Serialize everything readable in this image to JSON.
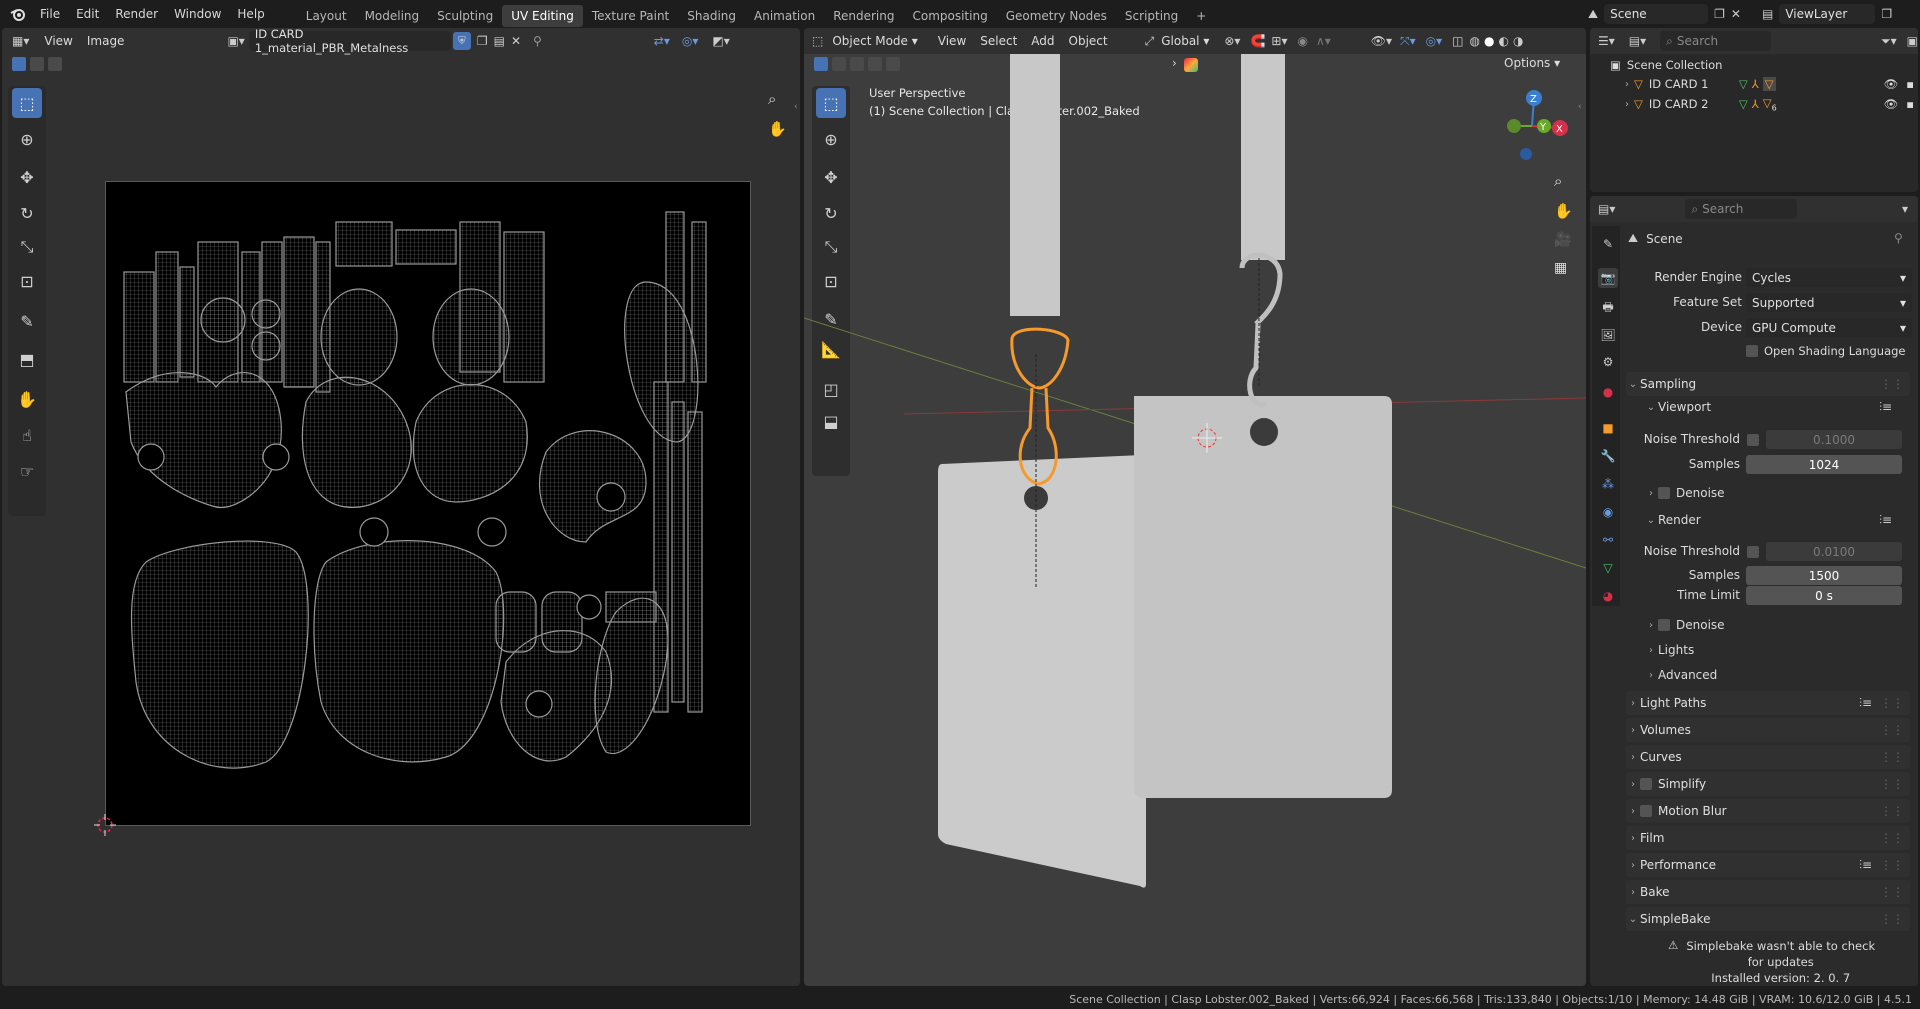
{
  "topbar": {
    "menus": [
      "File",
      "Edit",
      "Render",
      "Window",
      "Help"
    ],
    "workspaces": [
      "Layout",
      "Modeling",
      "Sculpting",
      "UV Editing",
      "Texture Paint",
      "Shading",
      "Animation",
      "Rendering",
      "Compositing",
      "Geometry Nodes",
      "Scripting"
    ],
    "active_workspace": "UV Editing",
    "add_tab": "+",
    "scene_name": "Scene",
    "view_layer": "ViewLayer"
  },
  "uv_editor": {
    "menus": [
      "View",
      "Image"
    ],
    "image_name": "ID CARD 1_material_PBR_Metalness"
  },
  "viewport": {
    "mode": "Object Mode",
    "menus": [
      "View",
      "Select",
      "Add",
      "Object"
    ],
    "transform_orientation": "Global",
    "options_label": "Options",
    "overlay_line1": "User Perspective",
    "overlay_line2": "(1) Scene Collection | Clasp Lobster.002_Baked",
    "gizmo_axes": [
      "Z",
      "Y",
      "X"
    ]
  },
  "outliner": {
    "search_placeholder": "Search",
    "root": "Scene Collection",
    "items": [
      {
        "label": "ID CARD 1",
        "badge": ""
      },
      {
        "label": "ID CARD 2",
        "badge": "6"
      }
    ]
  },
  "properties": {
    "search_placeholder": "Search",
    "context": "Scene",
    "render_engine_label": "Render Engine",
    "render_engine": "Cycles",
    "feature_set_label": "Feature Set",
    "feature_set": "Supported",
    "device_label": "Device",
    "device": "GPU Compute",
    "osl_label": "Open Shading Language",
    "sampling": {
      "title": "Sampling",
      "viewport": {
        "title": "Viewport",
        "noise_threshold_label": "Noise Threshold",
        "noise_threshold": "0.1000",
        "samples_label": "Samples",
        "samples": "1024",
        "denoise_label": "Denoise"
      },
      "render": {
        "title": "Render",
        "noise_threshold_label": "Noise Threshold",
        "noise_threshold": "0.0100",
        "samples_label": "Samples",
        "samples": "1500",
        "time_limit_label": "Time Limit",
        "time_limit": "0 s",
        "denoise_label": "Denoise"
      },
      "lights_label": "Lights",
      "advanced_label": "Advanced"
    },
    "sections": [
      "Light Paths",
      "Volumes",
      "Curves",
      "Simplify",
      "Motion Blur",
      "Film",
      "Performance",
      "Bake",
      "SimpleBake"
    ],
    "simplebake_warning": "Simplebake wasn't able to check",
    "simplebake_warning2": "for updates",
    "simplebake_version": "Installed version: 2. 0. 7"
  },
  "status_bar": "Scene Collection | Clasp Lobster.002_Baked | Verts:66,924 | Faces:66,568 | Tris:133,840 | Objects:1/10 | Memory: 14.48 GiB | VRAM: 10.6/12.0 GiB | 4.5.1",
  "colors": {
    "accent": "#4772b3",
    "selection": "#f59a2c",
    "bg": "#1d1d1d",
    "panel": "#303030"
  }
}
